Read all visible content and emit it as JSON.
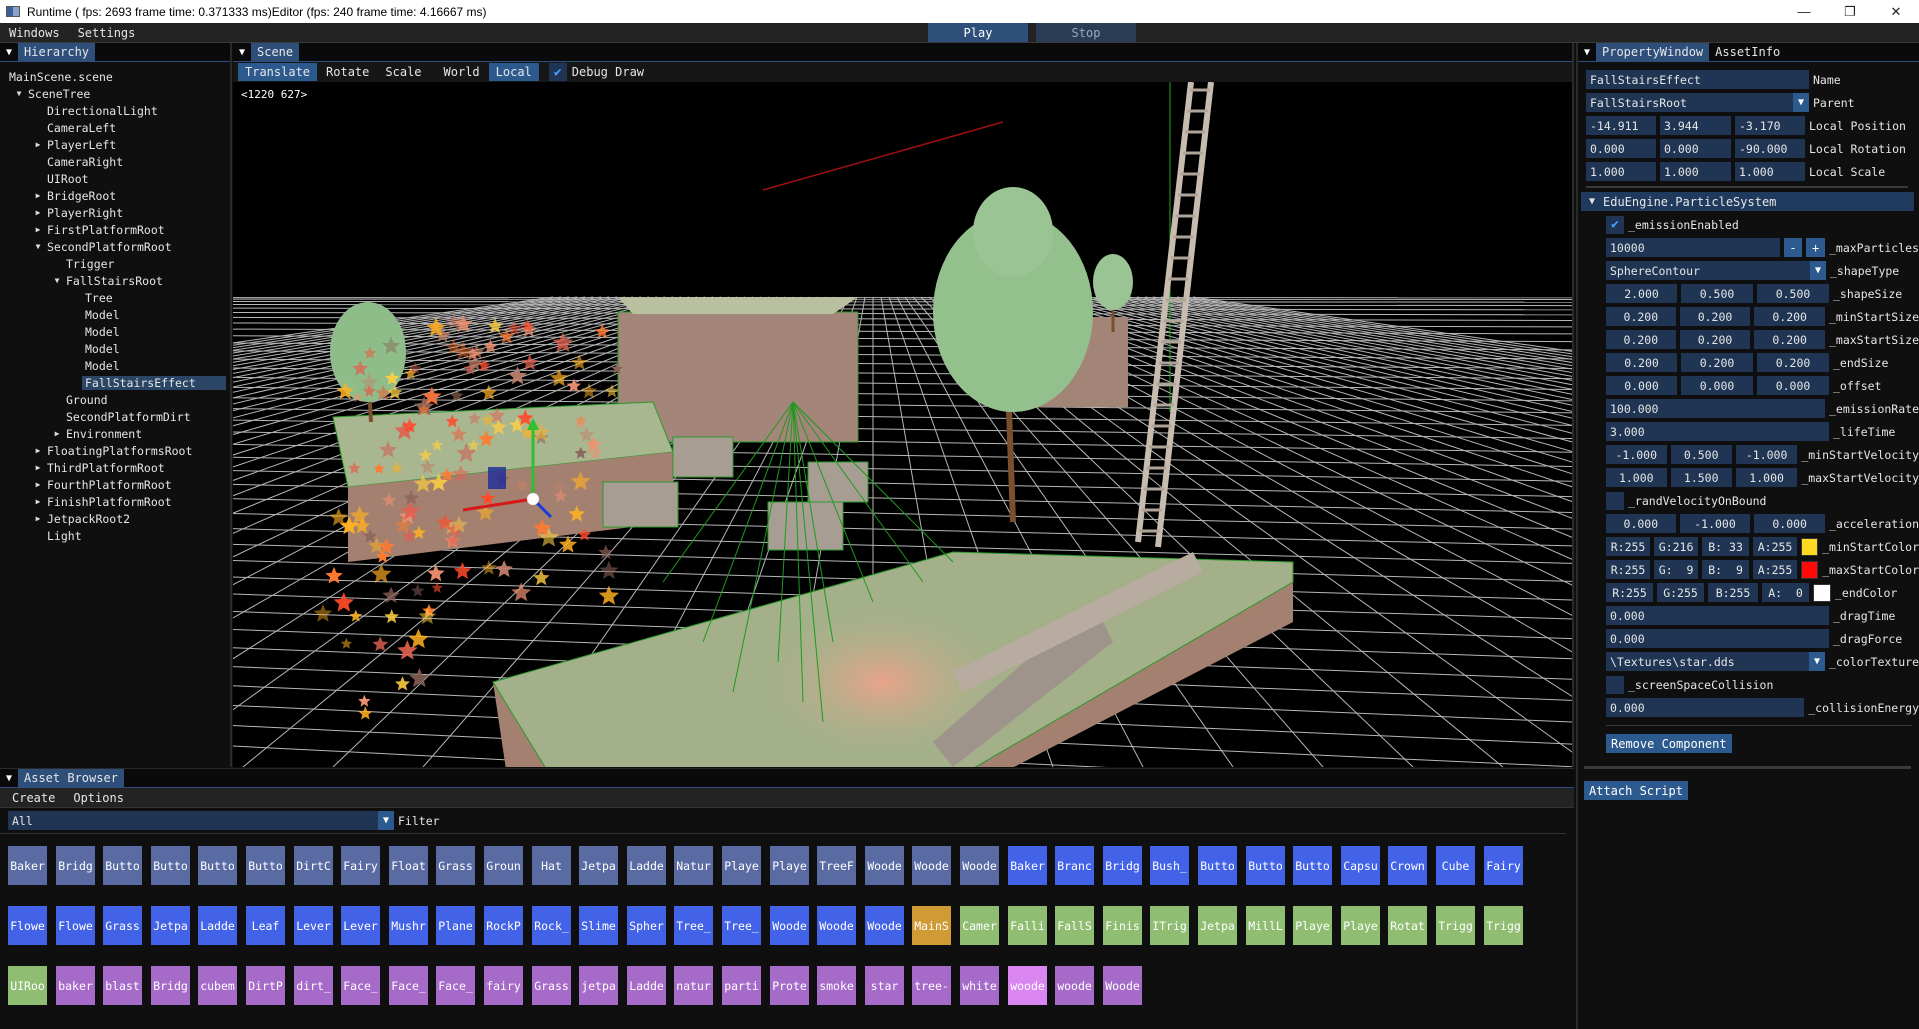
{
  "window": {
    "title": "Runtime ( fps: 2693 frame time: 0.371333 ms)Editor (fps: 240 frame time: 4.16667 ms)",
    "controls": [
      "minimize",
      "maximize",
      "close"
    ]
  },
  "menubar": {
    "items": [
      "Windows",
      "Settings"
    ],
    "play_label": "Play",
    "stop_label": "Stop"
  },
  "hierarchy": {
    "tab_label": "Hierarchy",
    "items": [
      {
        "label": "MainScene.scene",
        "depth": 0,
        "arrow": "none"
      },
      {
        "label": "SceneTree",
        "depth": 1,
        "arrow": "expanded"
      },
      {
        "label": "DirectionalLight",
        "depth": 2,
        "arrow": "none"
      },
      {
        "label": "CameraLeft",
        "depth": 2,
        "arrow": "none"
      },
      {
        "label": "PlayerLeft",
        "depth": 2,
        "arrow": "collapsed"
      },
      {
        "label": "CameraRight",
        "depth": 2,
        "arrow": "none"
      },
      {
        "label": "UIRoot",
        "depth": 2,
        "arrow": "none"
      },
      {
        "label": "BridgeRoot",
        "depth": 2,
        "arrow": "collapsed"
      },
      {
        "label": "PlayerRight",
        "depth": 2,
        "arrow": "collapsed"
      },
      {
        "label": "FirstPlatformRoot",
        "depth": 2,
        "arrow": "collapsed"
      },
      {
        "label": "SecondPlatformRoot",
        "depth": 2,
        "arrow": "expanded"
      },
      {
        "label": "Trigger",
        "depth": 3,
        "arrow": "none"
      },
      {
        "label": "FallStairsRoot",
        "depth": 3,
        "arrow": "expanded"
      },
      {
        "label": "Tree",
        "depth": 4,
        "arrow": "none"
      },
      {
        "label": "Model",
        "depth": 4,
        "arrow": "none"
      },
      {
        "label": "Model",
        "depth": 4,
        "arrow": "none"
      },
      {
        "label": "Model",
        "depth": 4,
        "arrow": "none"
      },
      {
        "label": "Model",
        "depth": 4,
        "arrow": "none"
      },
      {
        "label": "FallStairsEffect",
        "depth": 4,
        "arrow": "none",
        "selected": true
      },
      {
        "label": "Ground",
        "depth": 3,
        "arrow": "none"
      },
      {
        "label": "SecondPlatformDirt",
        "depth": 3,
        "arrow": "none"
      },
      {
        "label": "Environment",
        "depth": 3,
        "arrow": "collapsed"
      },
      {
        "label": "FloatingPlatformsRoot",
        "depth": 2,
        "arrow": "collapsed"
      },
      {
        "label": "ThirdPlatformRoot",
        "depth": 2,
        "arrow": "collapsed"
      },
      {
        "label": "FourthPlatformRoot",
        "depth": 2,
        "arrow": "collapsed"
      },
      {
        "label": "FinishPlatformRoot",
        "depth": 2,
        "arrow": "collapsed"
      },
      {
        "label": "JetpackRoot2",
        "depth": 2,
        "arrow": "collapsed"
      },
      {
        "label": "Light",
        "depth": 2,
        "arrow": "none"
      }
    ]
  },
  "scene": {
    "tab_label": "Scene",
    "toolbar": {
      "translate": "Translate",
      "rotate": "Rotate",
      "scale": "Scale",
      "world": "World",
      "local": "Local",
      "debug_draw": "Debug Draw",
      "debug_draw_checked": true,
      "active_tool": "Translate",
      "active_space": "Local"
    },
    "cursor_readout": "<1220  627>"
  },
  "property": {
    "tabs": [
      "PropertyWindow",
      "AssetInfo"
    ],
    "name_value": "FallStairsEffect",
    "name_label": "Name",
    "parent_value": "FallStairsRoot",
    "parent_label": "Parent",
    "local_position": [
      "-14.911",
      "3.944",
      "-3.170"
    ],
    "local_position_label": "Local Position",
    "local_rotation": [
      "0.000",
      "0.000",
      "-90.000"
    ],
    "local_rotation_label": "Local Rotation",
    "local_scale": [
      "1.000",
      "1.000",
      "1.000"
    ],
    "local_scale_label": "Local Scale",
    "component": {
      "title": "EduEngine.ParticleSystem",
      "emission_enabled_label": "_emissionEnabled",
      "emission_enabled": true,
      "max_particles": "10000",
      "max_particles_label": "_maxParticles",
      "minus": "-",
      "plus": "+",
      "shape_type": "SphereContour",
      "shape_type_label": "_shapeType",
      "vec_rows": [
        {
          "label": "_shapeSize",
          "values": [
            "2.000",
            "0.500",
            "0.500"
          ]
        },
        {
          "label": "_minStartSize",
          "values": [
            "0.200",
            "0.200",
            "0.200"
          ]
        },
        {
          "label": "_maxStartSize",
          "values": [
            "0.200",
            "0.200",
            "0.200"
          ]
        },
        {
          "label": "_endSize",
          "values": [
            "0.200",
            "0.200",
            "0.200"
          ]
        },
        {
          "label": "_offset",
          "values": [
            "0.000",
            "0.000",
            "0.000"
          ]
        }
      ],
      "emission_rate": "100.000",
      "emission_rate_label": "_emissionRate",
      "life_time": "3.000",
      "life_time_label": "_lifeTime",
      "min_start_velocity": [
        "-1.000",
        "0.500",
        "-1.000"
      ],
      "min_start_velocity_label": "_minStartVelocity",
      "max_start_velocity": [
        "1.000",
        "1.500",
        "1.000"
      ],
      "max_start_velocity_label": "_maxStartVelocity",
      "rand_velocity_label": "_randVelocityOnBound",
      "rand_velocity": false,
      "acceleration": [
        "0.000",
        "-1.000",
        "0.000"
      ],
      "acceleration_label": "_acceleration",
      "colors": [
        {
          "label": "_minStartColor",
          "r": "R:255",
          "g": "G:216",
          "b": "B: 33",
          "a": "A:255",
          "swatch": "#ffd821"
        },
        {
          "label": "_maxStartColor",
          "r": "R:255",
          "g": "G:  9",
          "b": "B:  9",
          "a": "A:255",
          "swatch": "#ff0909"
        },
        {
          "label": "_endColor",
          "r": "R:255",
          "g": "G:255",
          "b": "B:255",
          "a": "A:  0",
          "swatch": "#ffffff"
        }
      ],
      "drag_time": "0.000",
      "drag_time_label": "_dragTime",
      "drag_force": "0.000",
      "drag_force_label": "_dragForce",
      "color_texture": "\\Textures\\star.dds",
      "color_texture_label": "_colorTexture",
      "screen_space_collision_label": "_screenSpaceCollision",
      "screen_space_collision": false,
      "collision_energy": "0.000",
      "collision_energy_label": "_collisionEnergy",
      "remove_label": "Remove Component"
    },
    "attach_script_label": "Attach Script"
  },
  "assets": {
    "tab_label": "Asset Browser",
    "menu": [
      "Create",
      "Options"
    ],
    "filter_value": "All",
    "filter_label": "Filter",
    "type_colors": {
      "model": "#5a6ba3",
      "texture": "#4263e8",
      "scene": "#d09a35",
      "script": "#8fbd72",
      "material": "#a66ac9",
      "material_highlight": "#d985f2"
    },
    "rows": [
      [
        {
          "label": "Baker",
          "type": "model"
        },
        {
          "label": "Bridg",
          "type": "model"
        },
        {
          "label": "Butto",
          "type": "model"
        },
        {
          "label": "Butto",
          "type": "model"
        },
        {
          "label": "Butto",
          "type": "model"
        },
        {
          "label": "Butto",
          "type": "model"
        },
        {
          "label": "DirtC",
          "type": "model"
        },
        {
          "label": "Fairy",
          "type": "model"
        },
        {
          "label": "Float",
          "type": "model"
        },
        {
          "label": "Grass",
          "type": "model"
        },
        {
          "label": "Groun",
          "type": "model"
        },
        {
          "label": "Hat",
          "type": "model"
        },
        {
          "label": "Jetpa",
          "type": "model"
        },
        {
          "label": "Ladde",
          "type": "model"
        },
        {
          "label": "Natur",
          "type": "model"
        },
        {
          "label": "Playe",
          "type": "model"
        },
        {
          "label": "Playe",
          "type": "model"
        },
        {
          "label": "TreeF",
          "type": "model"
        },
        {
          "label": "Woode",
          "type": "model"
        },
        {
          "label": "Woode",
          "type": "model"
        },
        {
          "label": "Woode",
          "type": "model"
        },
        {
          "label": "Baker",
          "type": "texture"
        },
        {
          "label": "Branc",
          "type": "texture"
        },
        {
          "label": "Bridg",
          "type": "texture"
        },
        {
          "label": "Bush_",
          "type": "texture"
        },
        {
          "label": "Butto",
          "type": "texture"
        },
        {
          "label": "Butto",
          "type": "texture"
        },
        {
          "label": "Butto",
          "type": "texture"
        },
        {
          "label": "Capsu",
          "type": "texture"
        },
        {
          "label": "Crown",
          "type": "texture"
        },
        {
          "label": "Cube",
          "type": "texture"
        },
        {
          "label": "Fairy",
          "type": "texture"
        }
      ],
      [
        {
          "label": "Flowe",
          "type": "texture"
        },
        {
          "label": "Flowe",
          "type": "texture"
        },
        {
          "label": "Grass",
          "type": "texture"
        },
        {
          "label": "Jetpa",
          "type": "texture"
        },
        {
          "label": "Ladde",
          "type": "texture"
        },
        {
          "label": "Leaf",
          "type": "texture"
        },
        {
          "label": "Lever",
          "type": "texture"
        },
        {
          "label": "Lever",
          "type": "texture"
        },
        {
          "label": "Mushr",
          "type": "texture"
        },
        {
          "label": "Plane",
          "type": "texture"
        },
        {
          "label": "RockP",
          "type": "texture"
        },
        {
          "label": "Rock_",
          "type": "texture"
        },
        {
          "label": "Slime",
          "type": "texture"
        },
        {
          "label": "Spher",
          "type": "texture"
        },
        {
          "label": "Tree_",
          "type": "texture"
        },
        {
          "label": "Tree_",
          "type": "texture"
        },
        {
          "label": "Woode",
          "type": "texture"
        },
        {
          "label": "Woode",
          "type": "texture"
        },
        {
          "label": "Woode",
          "type": "texture"
        },
        {
          "label": "MainS",
          "type": "scene"
        },
        {
          "label": "Camer",
          "type": "script"
        },
        {
          "label": "Falli",
          "type": "script"
        },
        {
          "label": "FallS",
          "type": "script"
        },
        {
          "label": "Finis",
          "type": "script"
        },
        {
          "label": "ITrig",
          "type": "script"
        },
        {
          "label": "Jetpa",
          "type": "script"
        },
        {
          "label": "MillL",
          "type": "script"
        },
        {
          "label": "Playe",
          "type": "script"
        },
        {
          "label": "Playe",
          "type": "script"
        },
        {
          "label": "Rotat",
          "type": "script"
        },
        {
          "label": "Trigg",
          "type": "script"
        },
        {
          "label": "Trigg",
          "type": "script"
        }
      ],
      [
        {
          "label": "UIRoo",
          "type": "script"
        },
        {
          "label": "baker",
          "type": "material"
        },
        {
          "label": "blast",
          "type": "material"
        },
        {
          "label": "Bridg",
          "type": "material"
        },
        {
          "label": "cubem",
          "type": "material"
        },
        {
          "label": "DirtP",
          "type": "material"
        },
        {
          "label": "dirt_",
          "type": "material"
        },
        {
          "label": "Face_",
          "type": "material"
        },
        {
          "label": "Face_",
          "type": "material"
        },
        {
          "label": "Face_",
          "type": "material"
        },
        {
          "label": "fairy",
          "type": "material"
        },
        {
          "label": "Grass",
          "type": "material"
        },
        {
          "label": "jetpa",
          "type": "material"
        },
        {
          "label": "Ladde",
          "type": "material"
        },
        {
          "label": "natur",
          "type": "material"
        },
        {
          "label": "parti",
          "type": "material"
        },
        {
          "label": "Prote",
          "type": "material"
        },
        {
          "label": "smoke",
          "type": "material"
        },
        {
          "label": "star",
          "type": "material"
        },
        {
          "label": "tree-",
          "type": "material"
        },
        {
          "label": "white",
          "type": "material"
        },
        {
          "label": "woode",
          "type": "material_highlight"
        },
        {
          "label": "woode",
          "type": "material"
        },
        {
          "label": "Woode",
          "type": "material"
        }
      ]
    ]
  }
}
